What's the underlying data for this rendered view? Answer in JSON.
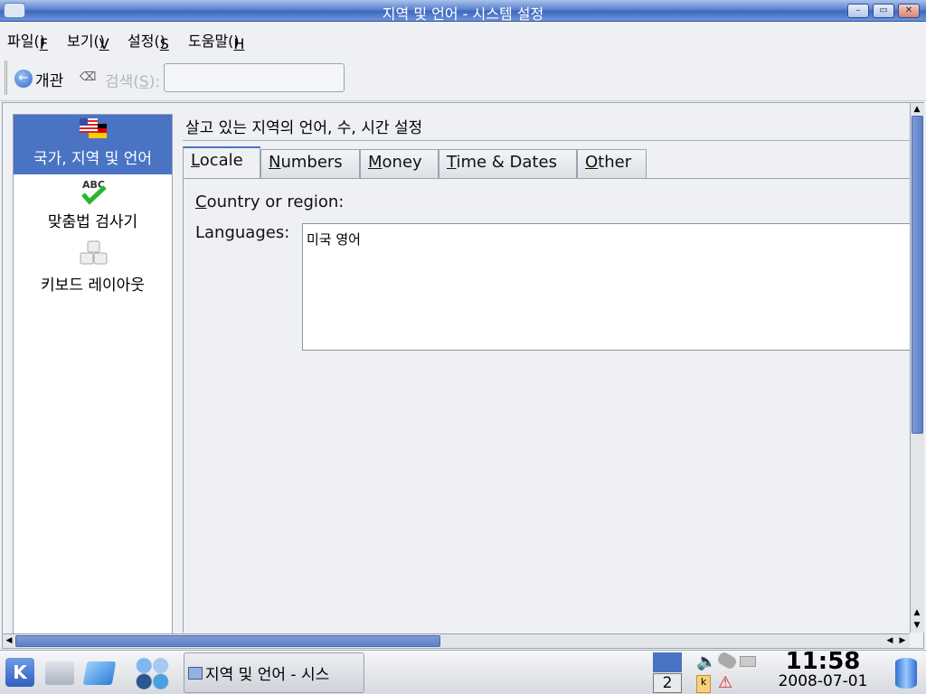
{
  "window": {
    "title": "지역 및 언어 - 시스템 설정",
    "controls": [
      "minimize",
      "maximize",
      "close"
    ]
  },
  "menu": [
    {
      "label": "파일(F)",
      "key": "F"
    },
    {
      "label": "보기(V)",
      "key": "V"
    },
    {
      "label": "설정(S)",
      "key": "S"
    },
    {
      "label": "도움말(H)",
      "key": "H"
    }
  ],
  "toolbar": {
    "overview_label": "개관",
    "search_label": "검색(S):",
    "search_key": "S",
    "search_value": ""
  },
  "sidebar": {
    "items": [
      {
        "label": "국가, 지역 및 언어",
        "icon": "flags-icon",
        "selected": true
      },
      {
        "label": "맞춤법 검사기",
        "icon": "spellcheck-icon"
      },
      {
        "label": "키보드 레이아웃",
        "icon": "keyboard-icon"
      }
    ]
  },
  "content": {
    "heading": "살고 있는 지역의 언어, 수, 시간 설정",
    "tabs": [
      {
        "label": "Locale",
        "key": "L",
        "active": true
      },
      {
        "label": "Numbers",
        "key": "N"
      },
      {
        "label": "Money",
        "key": "M"
      },
      {
        "label": "Time & Dates",
        "key": "T"
      },
      {
        "label": "Other",
        "key": "O"
      }
    ],
    "country_label": "Country or region:",
    "country_key": "C",
    "languages_label": "Languages:",
    "languages": [
      "미국 영어"
    ]
  },
  "taskbar": {
    "task_label": "지역 및 언어 - 시스",
    "desktop_number": "2",
    "time": "11:58",
    "date": "2008-07-01"
  },
  "colors": {
    "selection": "#4a73c4",
    "titlebar": "#3f68bf"
  }
}
